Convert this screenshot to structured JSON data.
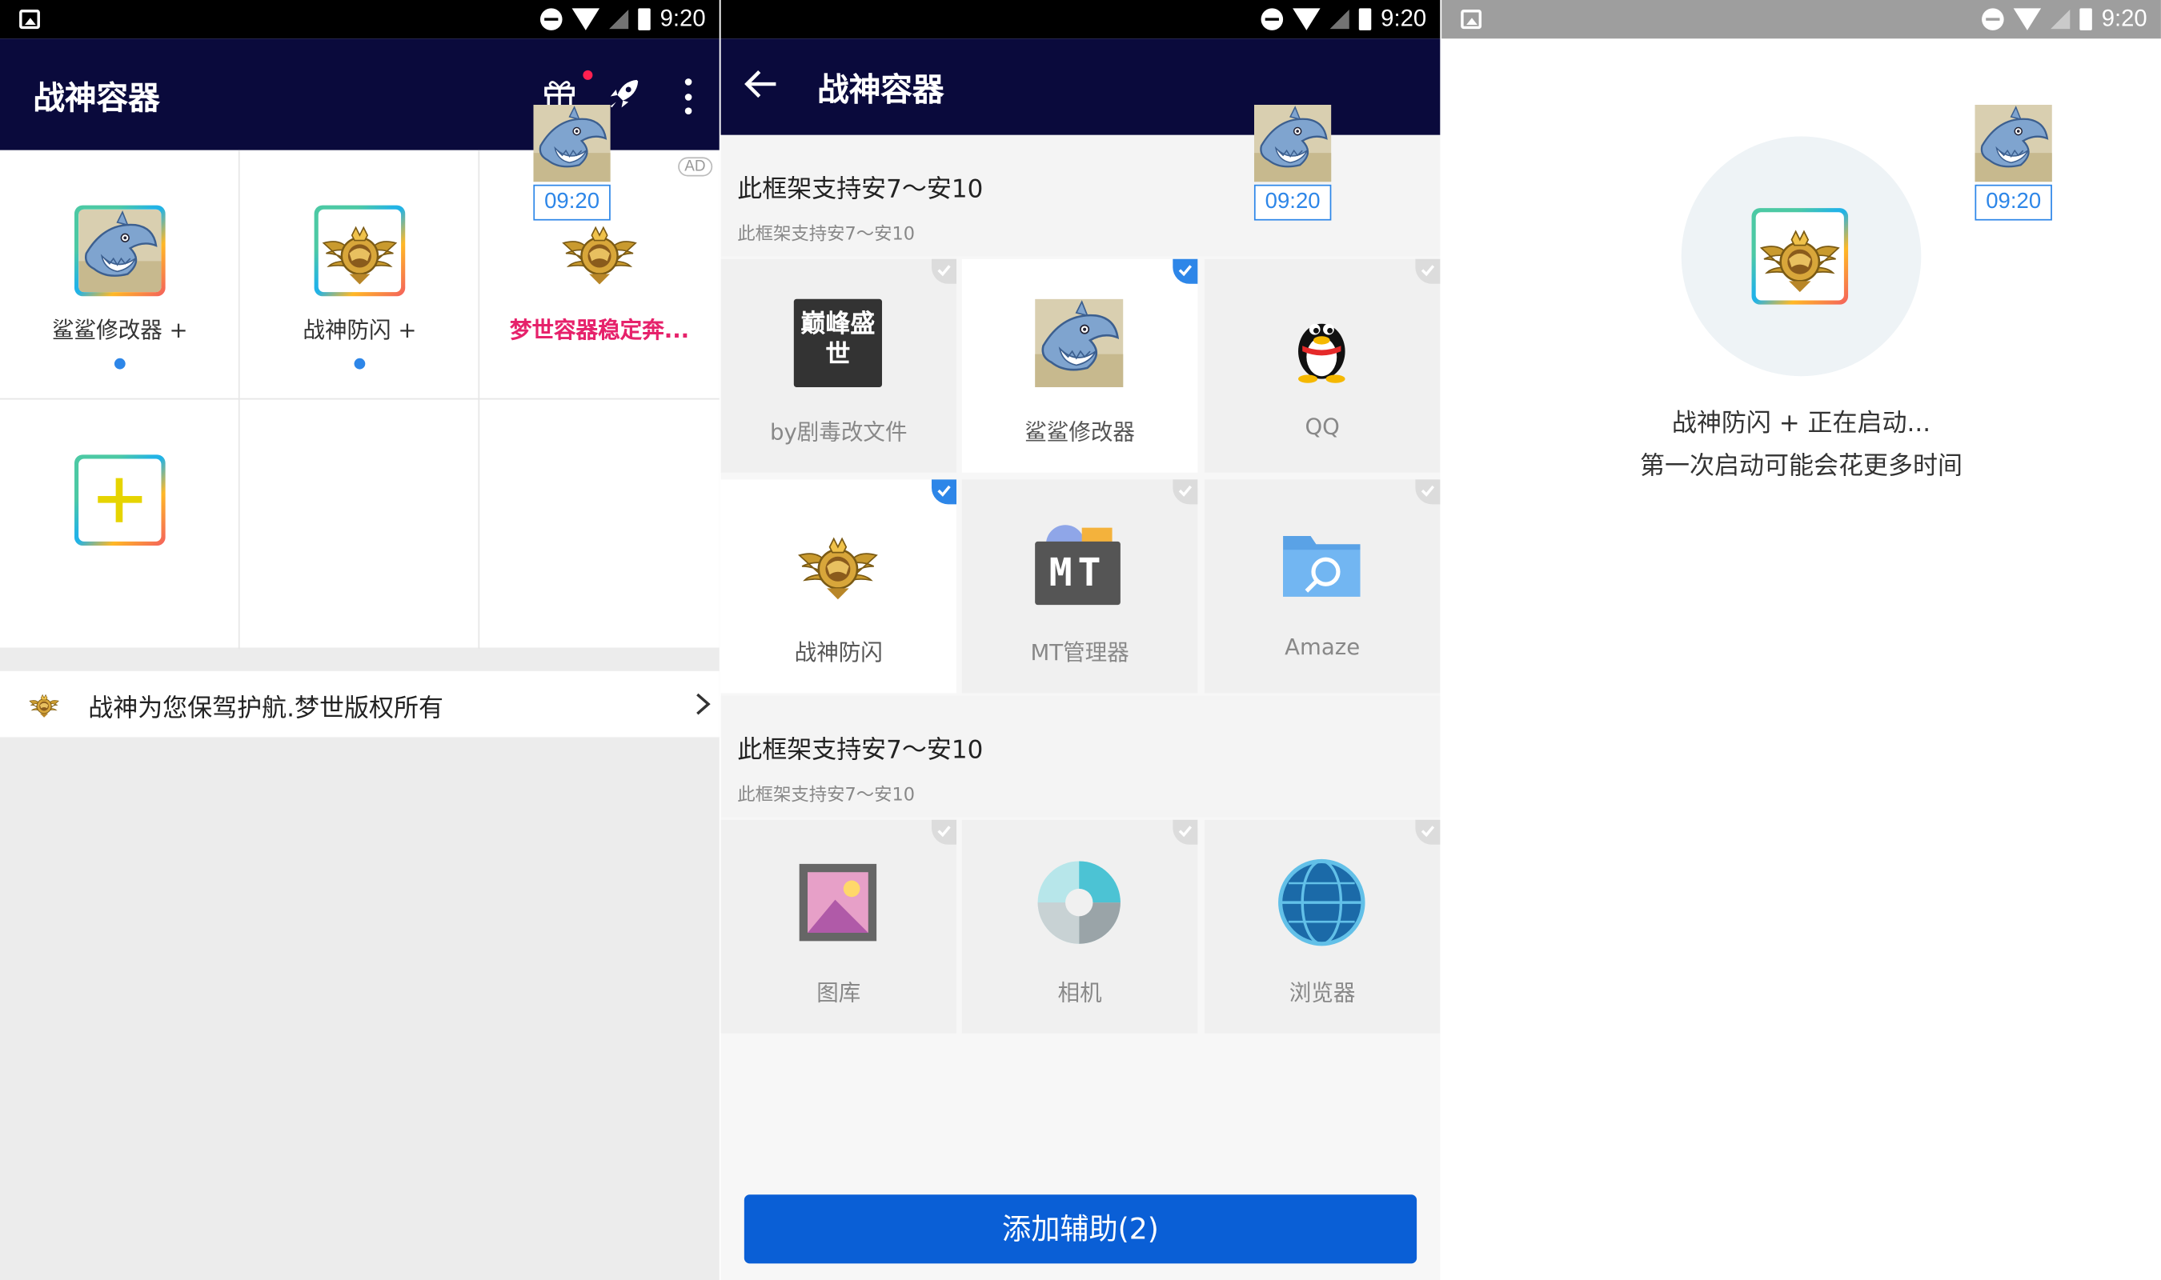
{
  "status_bar": {
    "time": "9:20"
  },
  "floating_widget": {
    "time": "09:20"
  },
  "screen1": {
    "title": "战神容器",
    "ad_badge": "AD",
    "apps": [
      {
        "label": "鲨鲨修改器 +",
        "icon": "shark-icon",
        "has_dot": true
      },
      {
        "label": "战神防闪 +",
        "icon": "emblem-icon",
        "has_dot": true
      },
      {
        "label": "梦世容器稳定奔...",
        "icon": "emblem-icon",
        "ad": "AD"
      }
    ],
    "banner_text": "战神为您保驾护航.梦世版权所有"
  },
  "screen2": {
    "title": "战神容器",
    "sections": [
      {
        "title": "此框架支持安7～安10",
        "subtitle": "此框架支持安7～安10",
        "items": [
          {
            "label": "by剧毒改文件",
            "icon": "peak-text-icon",
            "selected": false,
            "icon_text": "巅峰盛世"
          },
          {
            "label": "鲨鲨修改器",
            "icon": "shark-icon",
            "selected": true
          },
          {
            "label": "QQ",
            "icon": "qq-penguin-icon",
            "selected": false
          },
          {
            "label": "战神防闪",
            "icon": "emblem-icon",
            "selected": true
          },
          {
            "label": "MT管理器",
            "icon": "mt-manager-icon",
            "selected": false,
            "icon_text": "MT"
          },
          {
            "label": "Amaze",
            "icon": "folder-search-icon",
            "selected": false
          }
        ]
      },
      {
        "title": "此框架支持安7～安10",
        "subtitle": "此框架支持安7～安10",
        "items": [
          {
            "label": "图库",
            "icon": "gallery-icon",
            "selected": false
          },
          {
            "label": "相机",
            "icon": "camera-aperture-icon",
            "selected": false
          },
          {
            "label": "浏览器",
            "icon": "globe-icon",
            "selected": false
          }
        ]
      }
    ],
    "add_button": "添加辅助(2)"
  },
  "screen3": {
    "line1": "战神防闪 + 正在启动...",
    "line2": "第一次启动可能会花更多时间"
  },
  "colors": {
    "appbar": "#0a0a3c",
    "accent_blue": "#2d86e8",
    "button_blue": "#0a5fd6",
    "ad_pink": "#e6226b"
  }
}
